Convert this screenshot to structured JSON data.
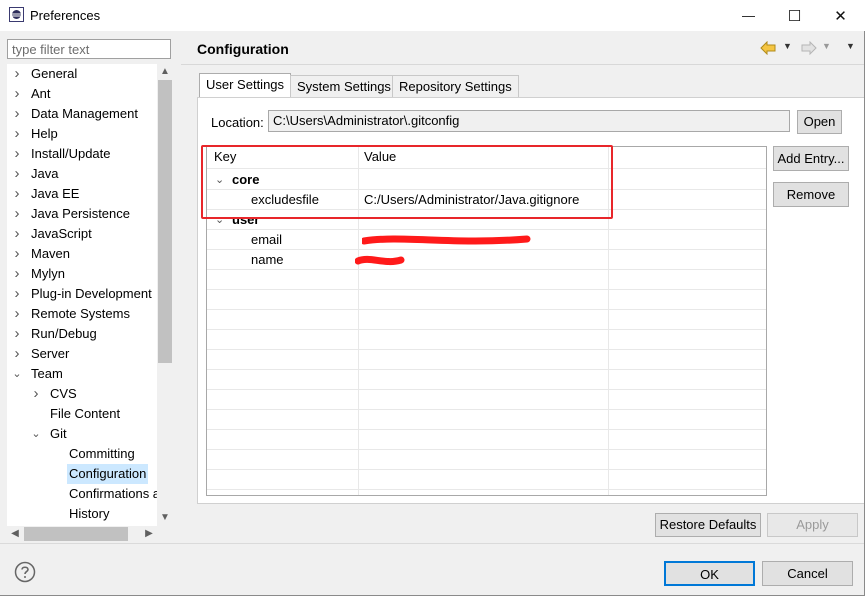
{
  "window": {
    "title": "Preferences",
    "minimize_glyph": "—",
    "maximize_glyph": "☐",
    "close_glyph": "✕"
  },
  "filter": {
    "placeholder": "type filter text",
    "value": ""
  },
  "tree": [
    {
      "label": "General",
      "expanded": false
    },
    {
      "label": "Ant",
      "expanded": false
    },
    {
      "label": "Data Management",
      "expanded": false
    },
    {
      "label": "Help",
      "expanded": false
    },
    {
      "label": "Install/Update",
      "expanded": false
    },
    {
      "label": "Java",
      "expanded": false
    },
    {
      "label": "Java EE",
      "expanded": false
    },
    {
      "label": "Java Persistence",
      "expanded": false
    },
    {
      "label": "JavaScript",
      "expanded": false
    },
    {
      "label": "Maven",
      "expanded": false
    },
    {
      "label": "Mylyn",
      "expanded": false
    },
    {
      "label": "Plug-in Development",
      "expanded": false
    },
    {
      "label": "Remote Systems",
      "expanded": false
    },
    {
      "label": "Run/Debug",
      "expanded": false
    },
    {
      "label": "Server",
      "expanded": false
    },
    {
      "label": "Team",
      "expanded": true
    },
    {
      "label": "CVS",
      "expanded": false
    },
    {
      "label": "File Content"
    },
    {
      "label": "Git",
      "expanded": true
    },
    {
      "label": "Committing"
    },
    {
      "label": "Configuration",
      "selected": true
    },
    {
      "label": "Confirmations a"
    },
    {
      "label": "History"
    }
  ],
  "page": {
    "title": "Configuration"
  },
  "tabs": [
    {
      "label": "User Settings",
      "active": true
    },
    {
      "label": "System Settings",
      "active": false
    },
    {
      "label": "Repository Settings",
      "active": false
    }
  ],
  "location": {
    "label": "Location:",
    "value": "C:\\Users\\Administrator\\.gitconfig",
    "open_label": "Open"
  },
  "config_table": {
    "headers": [
      "Key",
      "Value"
    ],
    "rows": [
      {
        "key": "core",
        "value": "",
        "section": true
      },
      {
        "key": "excludesfile",
        "value": "C:/Users/Administrator/Java.gitignore"
      },
      {
        "key": "user",
        "value": "",
        "section": true
      },
      {
        "key": "email",
        "value": ""
      },
      {
        "key": "name",
        "value": ""
      }
    ]
  },
  "side_buttons": {
    "add": "Add Entry...",
    "remove": "Remove"
  },
  "buttons": {
    "restore_defaults": "Restore Defaults",
    "apply": "Apply",
    "ok": "OK",
    "cancel": "Cancel"
  },
  "colors": {
    "selection": "#cce8ff",
    "highlight_box": "#e8262a",
    "redaction": "#ff1a1a",
    "ok_border": "#0078d7"
  }
}
